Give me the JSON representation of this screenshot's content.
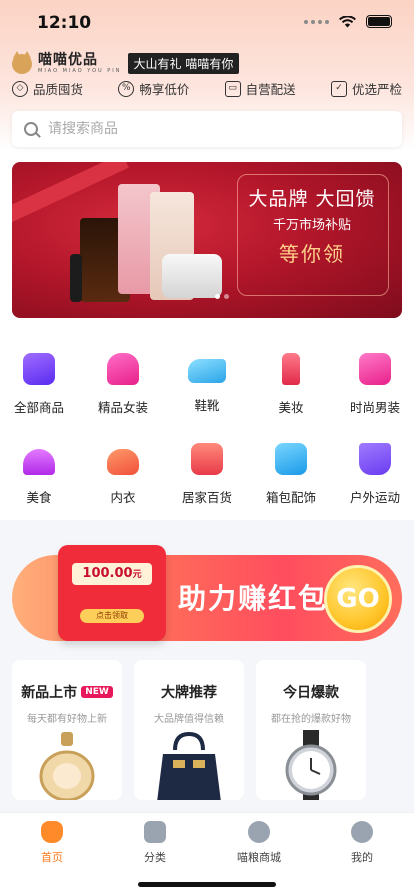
{
  "status": {
    "time": "12:10"
  },
  "brand": {
    "name": "喵喵优品",
    "sub": "MIAO MIAO YOU PIN",
    "slogan": "大山有礼 喵喵有你"
  },
  "features": [
    {
      "label": "品质囤货",
      "icon": "diamond-icon"
    },
    {
      "label": "畅享低价",
      "icon": "discount-icon"
    },
    {
      "label": "自营配送",
      "icon": "truck-icon"
    },
    {
      "label": "优选严检",
      "icon": "thumb-up-icon"
    }
  ],
  "search": {
    "placeholder": "请搜索商品"
  },
  "banner": {
    "title": "大品牌  大回馈",
    "subtitle": "千万市场补贴",
    "highlight": "等你领"
  },
  "categories": [
    {
      "label": "全部商品",
      "icon": "shopping-bag-icon",
      "color": "#6a3cf0"
    },
    {
      "label": "精品女装",
      "icon": "dress-icon",
      "color": "#f03ca0"
    },
    {
      "label": "鞋靴",
      "icon": "sneaker-icon",
      "color": "#3cb8f0"
    },
    {
      "label": "美妆",
      "icon": "lipstick-icon",
      "color": "#f0506a"
    },
    {
      "label": "时尚男装",
      "icon": "shirt-icon",
      "color": "#f03c9a"
    },
    {
      "label": "美食",
      "icon": "dish-icon",
      "color": "#c03cf0"
    },
    {
      "label": "内衣",
      "icon": "lingerie-icon",
      "color": "#f06040"
    },
    {
      "label": "居家百货",
      "icon": "store-icon",
      "color": "#f05a5a"
    },
    {
      "label": "箱包配饰",
      "icon": "handbag-icon",
      "color": "#2ab4f0"
    },
    {
      "label": "户外运动",
      "icon": "cart-icon",
      "color": "#7a4cf0"
    }
  ],
  "promo": {
    "coupon": "100.00",
    "coupon_unit": "元",
    "claim": "点击领取",
    "text": "助力赚红包",
    "go": "GO"
  },
  "cards": [
    {
      "title": "新品上市",
      "badge": "NEW",
      "sub": "每天都有好物上新",
      "image": "perfume-icon"
    },
    {
      "title": "大牌推荐",
      "badge": "",
      "sub": "大品牌值得信赖",
      "image": "handbag-product-icon"
    },
    {
      "title": "今日爆款",
      "badge": "",
      "sub": "都在抢的爆款好物",
      "image": "watch-icon"
    }
  ],
  "tabs": [
    {
      "label": "首页",
      "icon": "home-icon",
      "active": true
    },
    {
      "label": "分类",
      "icon": "category-icon",
      "active": false
    },
    {
      "label": "喵粮商城",
      "icon": "mall-icon",
      "active": false
    },
    {
      "label": "我的",
      "icon": "profile-icon",
      "active": false
    }
  ],
  "colors": {
    "accent": "#ff7a1a",
    "banner": "#b3162a",
    "promo": "#ff4d5e"
  }
}
